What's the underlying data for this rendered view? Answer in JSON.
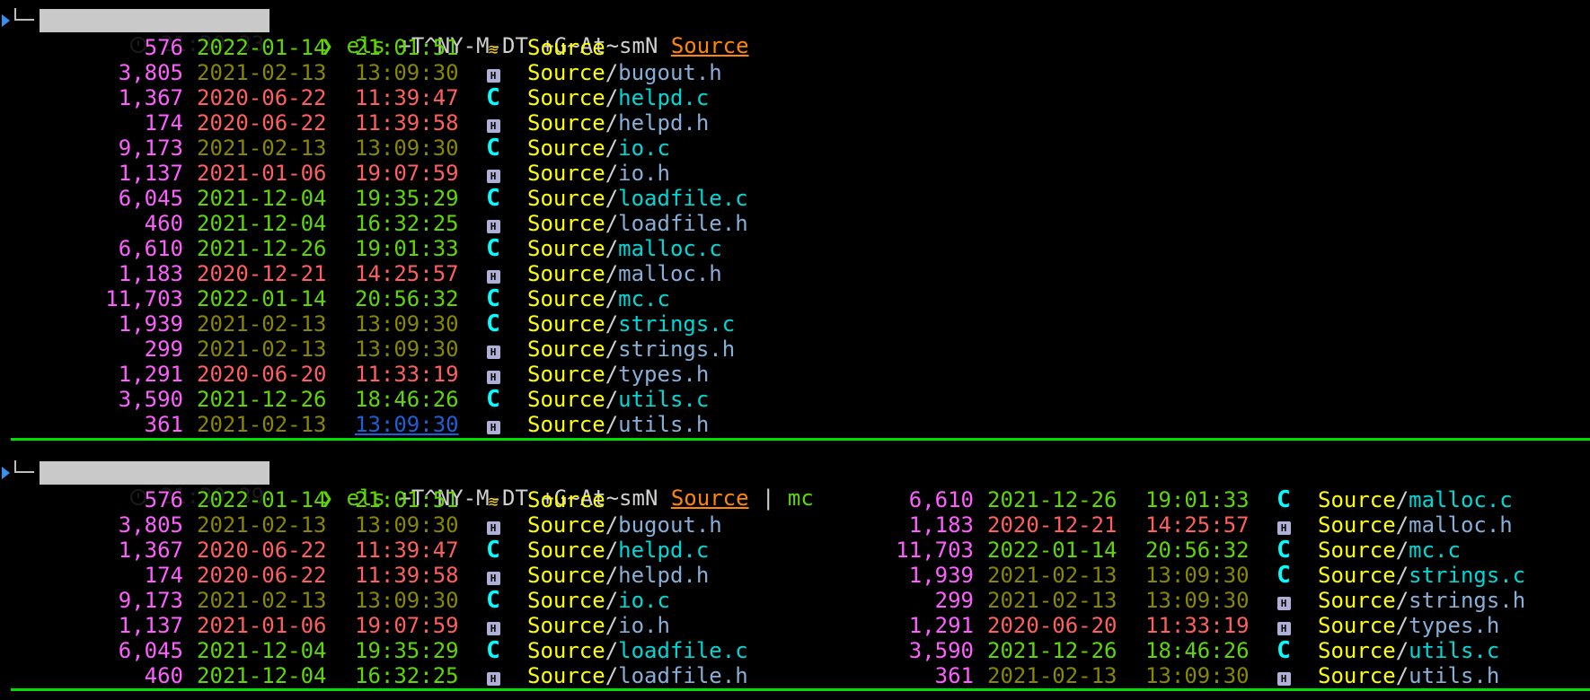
{
  "terminal": {
    "colors": {
      "background": "#000000",
      "prompt_green": "#5fd700",
      "size_magenta": "#ff5fff",
      "dir_yellow": "#ffff00",
      "c_file_cyan": "#00d7d7",
      "h_file_blue": "#87afd7",
      "divider_green": "#00e000"
    },
    "blocks": [
      {
        "prompt": {
          "time": "21:30:33",
          "command": "els",
          "args": "+T^NY-M-DT +G~At~smN",
          "target": "Source",
          "pipe": "",
          "pipe_cmd": ""
        },
        "entries": [
          {
            "size": "576",
            "date": "2022-01-14",
            "time": "21:01:51",
            "icon": "source-dir-icon",
            "dir": "Source",
            "name": "",
            "kind": "dir",
            "age": "new"
          },
          {
            "size": "3,805",
            "date": "2021-02-13",
            "time": "13:09:30",
            "icon": "h-file-icon",
            "dir": "Source",
            "name": "bugout.h",
            "kind": "h",
            "age": "mid"
          },
          {
            "size": "1,367",
            "date": "2020-06-22",
            "time": "11:39:47",
            "icon": "c-file-icon",
            "dir": "Source",
            "name": "helpd.c",
            "kind": "c",
            "age": "old"
          },
          {
            "size": "174",
            "date": "2020-06-22",
            "time": "11:39:58",
            "icon": "h-file-icon",
            "dir": "Source",
            "name": "helpd.h",
            "kind": "h",
            "age": "old"
          },
          {
            "size": "9,173",
            "date": "2021-02-13",
            "time": "13:09:30",
            "icon": "c-file-icon",
            "dir": "Source",
            "name": "io.c",
            "kind": "c",
            "age": "mid"
          },
          {
            "size": "1,137",
            "date": "2021-01-06",
            "time": "19:07:59",
            "icon": "h-file-icon",
            "dir": "Source",
            "name": "io.h",
            "kind": "h",
            "age": "old"
          },
          {
            "size": "6,045",
            "date": "2021-12-04",
            "time": "19:35:29",
            "icon": "c-file-icon",
            "dir": "Source",
            "name": "loadfile.c",
            "kind": "c",
            "age": "new"
          },
          {
            "size": "460",
            "date": "2021-12-04",
            "time": "16:32:25",
            "icon": "h-file-icon",
            "dir": "Source",
            "name": "loadfile.h",
            "kind": "h",
            "age": "new"
          },
          {
            "size": "6,610",
            "date": "2021-12-26",
            "time": "19:01:33",
            "icon": "c-file-icon",
            "dir": "Source",
            "name": "malloc.c",
            "kind": "c",
            "age": "new"
          },
          {
            "size": "1,183",
            "date": "2020-12-21",
            "time": "14:25:57",
            "icon": "h-file-icon",
            "dir": "Source",
            "name": "malloc.h",
            "kind": "h",
            "age": "old"
          },
          {
            "size": "11,703",
            "date": "2022-01-14",
            "time": "20:56:32",
            "icon": "c-file-icon",
            "dir": "Source",
            "name": "mc.c",
            "kind": "c",
            "age": "new"
          },
          {
            "size": "1,939",
            "date": "2021-02-13",
            "time": "13:09:30",
            "icon": "c-file-icon",
            "dir": "Source",
            "name": "strings.c",
            "kind": "c",
            "age": "mid"
          },
          {
            "size": "299",
            "date": "2021-02-13",
            "time": "13:09:30",
            "icon": "h-file-icon",
            "dir": "Source",
            "name": "strings.h",
            "kind": "h",
            "age": "mid"
          },
          {
            "size": "1,291",
            "date": "2020-06-20",
            "time": "11:33:19",
            "icon": "h-file-icon",
            "dir": "Source",
            "name": "types.h",
            "kind": "h",
            "age": "old"
          },
          {
            "size": "3,590",
            "date": "2021-12-26",
            "time": "18:46:26",
            "icon": "c-file-icon",
            "dir": "Source",
            "name": "utils.c",
            "kind": "c",
            "age": "new"
          },
          {
            "size": "361",
            "date": "2021-02-13",
            "time": "13:09:30",
            "icon": "h-file-icon",
            "dir": "Source",
            "name": "utils.h",
            "kind": "h",
            "age": "mid",
            "time_link": true
          }
        ]
      },
      {
        "prompt": {
          "time": "21:30:39",
          "command": "els",
          "args": "+T^NY-M-DT +G~At~smN",
          "target": "Source",
          "pipe": "|",
          "pipe_cmd": "mc"
        },
        "columns": [
          [
            {
              "size": "576",
              "date": "2022-01-14",
              "time": "21:01:51",
              "icon": "source-dir-icon",
              "dir": "Source",
              "name": "",
              "kind": "dir",
              "age": "new"
            },
            {
              "size": "3,805",
              "date": "2021-02-13",
              "time": "13:09:30",
              "icon": "h-file-icon",
              "dir": "Source",
              "name": "bugout.h",
              "kind": "h",
              "age": "mid"
            },
            {
              "size": "1,367",
              "date": "2020-06-22",
              "time": "11:39:47",
              "icon": "c-file-icon",
              "dir": "Source",
              "name": "helpd.c",
              "kind": "c",
              "age": "old"
            },
            {
              "size": "174",
              "date": "2020-06-22",
              "time": "11:39:58",
              "icon": "h-file-icon",
              "dir": "Source",
              "name": "helpd.h",
              "kind": "h",
              "age": "old"
            },
            {
              "size": "9,173",
              "date": "2021-02-13",
              "time": "13:09:30",
              "icon": "c-file-icon",
              "dir": "Source",
              "name": "io.c",
              "kind": "c",
              "age": "mid"
            },
            {
              "size": "1,137",
              "date": "2021-01-06",
              "time": "19:07:59",
              "icon": "h-file-icon",
              "dir": "Source",
              "name": "io.h",
              "kind": "h",
              "age": "old"
            },
            {
              "size": "6,045",
              "date": "2021-12-04",
              "time": "19:35:29",
              "icon": "c-file-icon",
              "dir": "Source",
              "name": "loadfile.c",
              "kind": "c",
              "age": "new"
            },
            {
              "size": "460",
              "date": "2021-12-04",
              "time": "16:32:25",
              "icon": "h-file-icon",
              "dir": "Source",
              "name": "loadfile.h",
              "kind": "h",
              "age": "new"
            }
          ],
          [
            {
              "size": "6,610",
              "date": "2021-12-26",
              "time": "19:01:33",
              "icon": "c-file-icon",
              "dir": "Source",
              "name": "malloc.c",
              "kind": "c",
              "age": "new"
            },
            {
              "size": "1,183",
              "date": "2020-12-21",
              "time": "14:25:57",
              "icon": "h-file-icon",
              "dir": "Source",
              "name": "malloc.h",
              "kind": "h",
              "age": "old"
            },
            {
              "size": "11,703",
              "date": "2022-01-14",
              "time": "20:56:32",
              "icon": "c-file-icon",
              "dir": "Source",
              "name": "mc.c",
              "kind": "c",
              "age": "new"
            },
            {
              "size": "1,939",
              "date": "2021-02-13",
              "time": "13:09:30",
              "icon": "c-file-icon",
              "dir": "Source",
              "name": "strings.c",
              "kind": "c",
              "age": "mid"
            },
            {
              "size": "299",
              "date": "2021-02-13",
              "time": "13:09:30",
              "icon": "h-file-icon",
              "dir": "Source",
              "name": "strings.h",
              "kind": "h",
              "age": "mid"
            },
            {
              "size": "1,291",
              "date": "2020-06-20",
              "time": "11:33:19",
              "icon": "h-file-icon",
              "dir": "Source",
              "name": "types.h",
              "kind": "h",
              "age": "old"
            },
            {
              "size": "3,590",
              "date": "2021-12-26",
              "time": "18:46:26",
              "icon": "c-file-icon",
              "dir": "Source",
              "name": "utils.c",
              "kind": "c",
              "age": "new"
            },
            {
              "size": "361",
              "date": "2021-02-13",
              "time": "13:09:30",
              "icon": "h-file-icon",
              "dir": "Source",
              "name": "utils.h",
              "kind": "h",
              "age": "mid"
            }
          ]
        ]
      }
    ]
  }
}
